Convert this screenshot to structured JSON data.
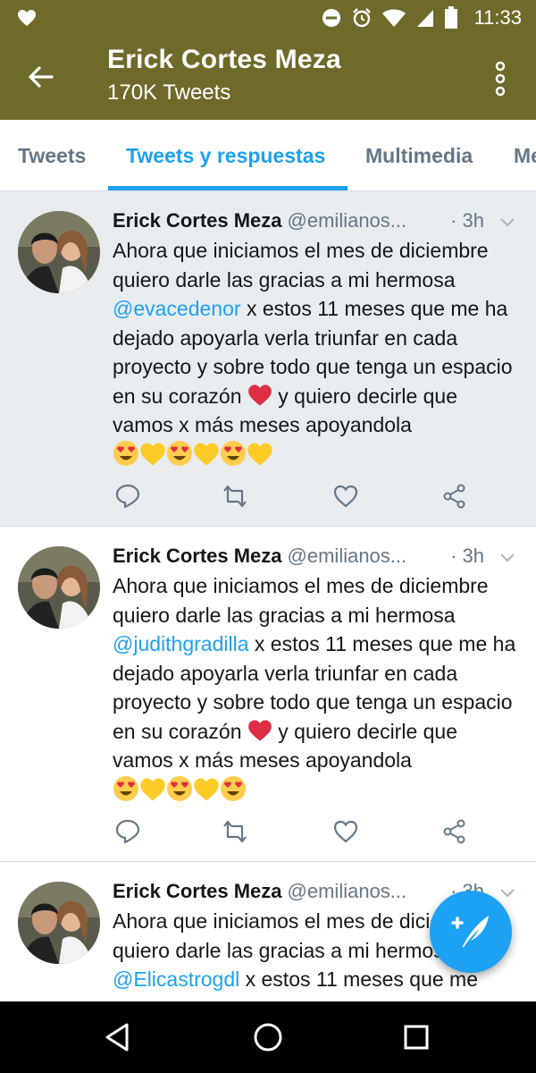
{
  "status_bar": {
    "time": "11:33",
    "icons": [
      "heart-icon",
      "do-not-disturb-icon",
      "alarm-icon",
      "wifi-icon",
      "signal-icon",
      "battery-icon"
    ]
  },
  "header": {
    "title": "Erick Cortes Meza",
    "subtitle": "170K Tweets",
    "icons": [
      "back-arrow-icon",
      "more-vertical-icon"
    ]
  },
  "tabs": [
    {
      "label": "Tweets",
      "active": false
    },
    {
      "label": "Tweets y respuestas",
      "active": true
    },
    {
      "label": "Multimedia",
      "active": false
    },
    {
      "label": "Me",
      "active": false
    }
  ],
  "tweets": [
    {
      "name": "Erick Cortes Meza",
      "handle": "@emilianos...",
      "time": "· 3h",
      "text_before": "Ahora que iniciamos el mes de diciembre quiero darle las gracias a mi hermosa ",
      "mention": "@evacedenor",
      "text_after": " x estos 11 meses que me ha dejado apoyarla verla triunfar en cada proyecto y sobre todo que tenga un espacio en su corazón ",
      "text_after2": " y quiero decirle que vamos x más meses apoyandola "
    },
    {
      "name": "Erick Cortes Meza",
      "handle": "@emilianos...",
      "time": "· 3h",
      "text_before": "Ahora que iniciamos el mes de diciembre quiero darle las gracias a mi hermosa ",
      "mention": "@judithgradilla",
      "text_after": " x estos 11 meses que me ha dejado apoyarla verla triunfar en cada proyecto y sobre todo que tenga un espacio en su corazón ",
      "text_after2": " y quiero decirle que vamos x más meses apoyandola "
    },
    {
      "name": "Erick Cortes Meza",
      "handle": "@emilianos...",
      "time": "· 3h",
      "text_before": "Ahora que iniciamos el mes de diciembre quiero darle las gracias a mi hermosa ",
      "mention": "@Elicastrogdl",
      "text_after": " x estos 11 meses que me",
      "text_after2": ""
    }
  ],
  "tweet_actions": [
    "reply-icon",
    "retweet-icon",
    "like-icon",
    "share-icon"
  ],
  "fab": {
    "icon": "compose-tweet-icon"
  },
  "nav_bar": {
    "icons": [
      "nav-back-icon",
      "nav-home-icon",
      "nav-recents-icon"
    ]
  },
  "colors": {
    "header_bg": "#6f6a2a",
    "accent": "#1da1f2",
    "muted": "#657786",
    "highlight_bg": "#e9ecef"
  }
}
